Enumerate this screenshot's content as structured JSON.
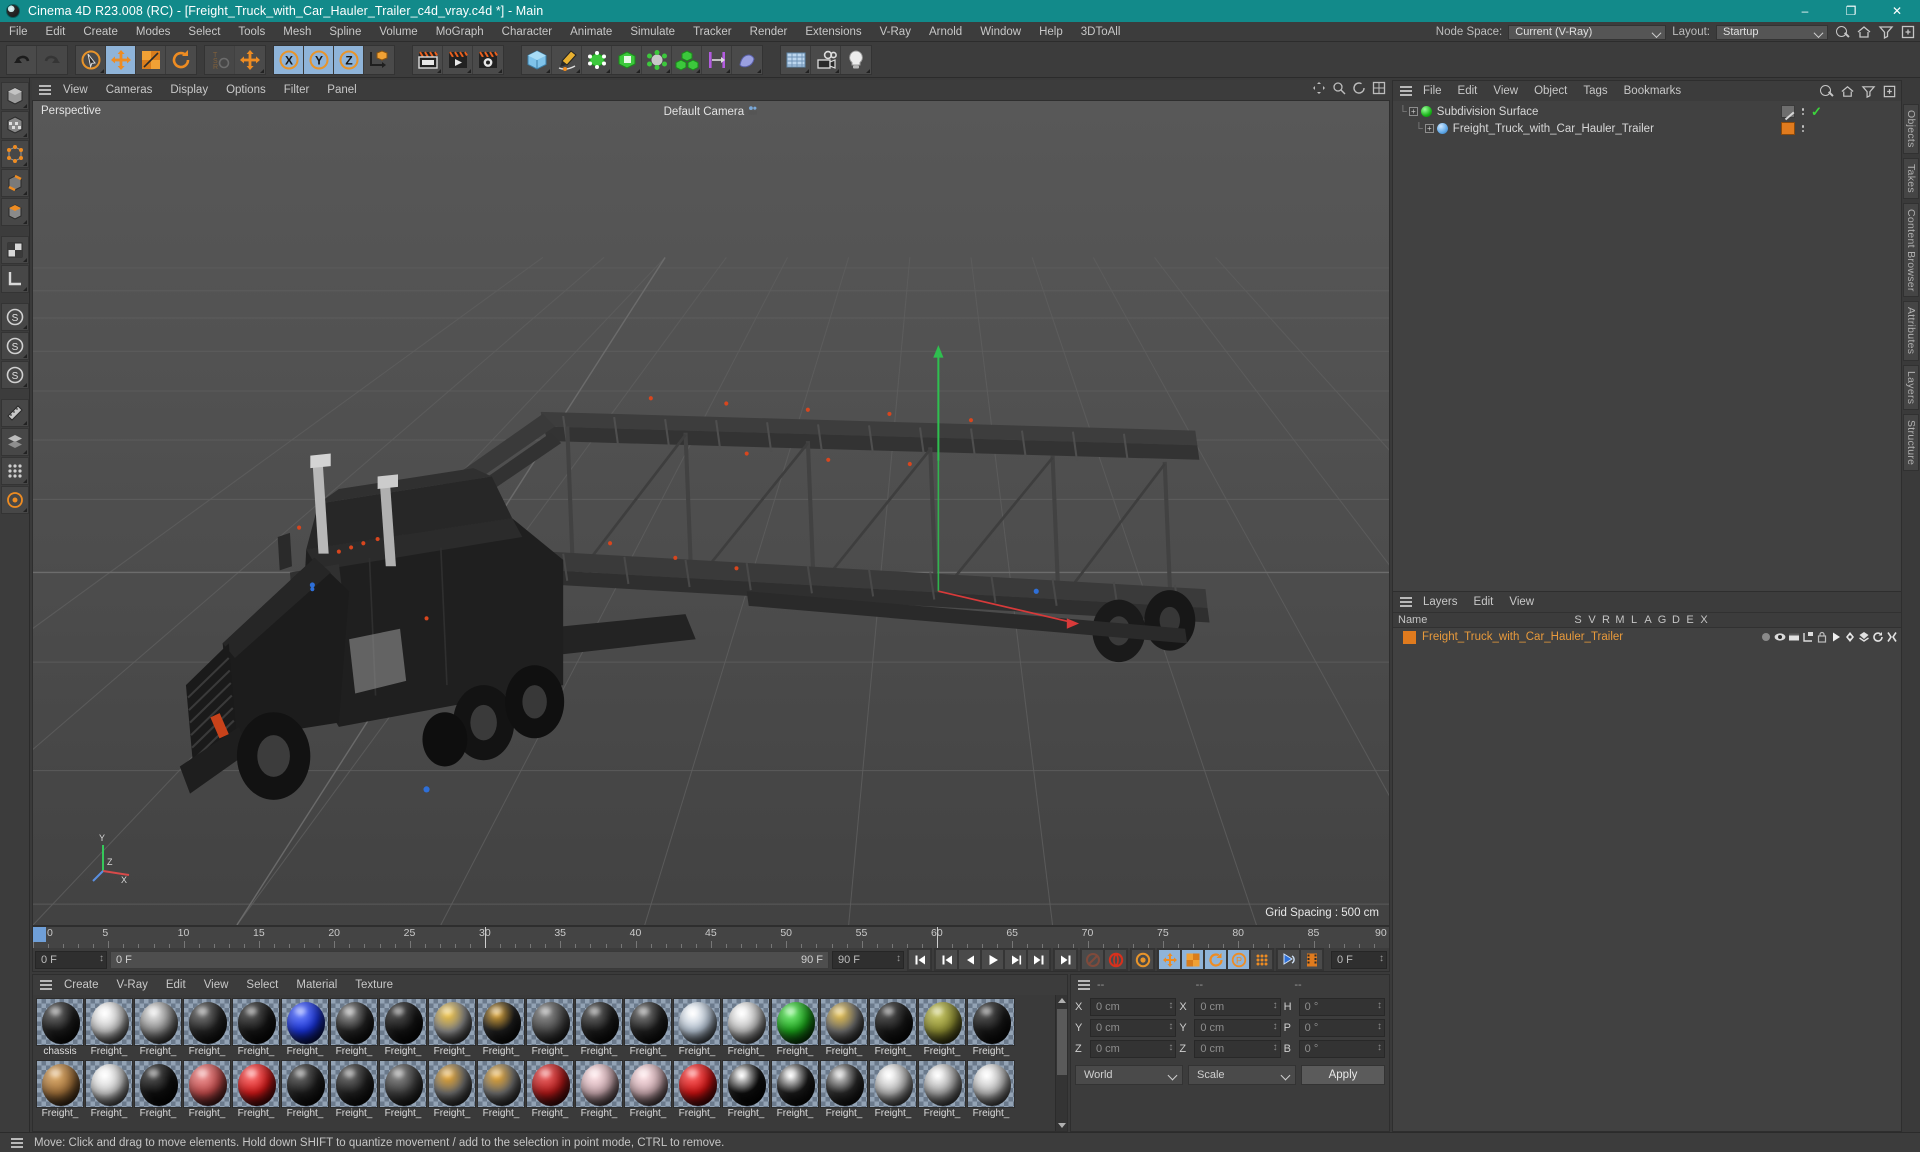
{
  "window": {
    "title": "Cinema 4D R23.008 (RC) - [Freight_Truck_with_Car_Hauler_Trailer_c4d_vray.c4d *] - Main",
    "minimize": "–",
    "maximize": "❐",
    "close": "✕",
    "accent": "#128a8a"
  },
  "menubar": {
    "items": [
      "File",
      "Edit",
      "Create",
      "Modes",
      "Select",
      "Tools",
      "Mesh",
      "Spline",
      "Volume",
      "MoGraph",
      "Character",
      "Animate",
      "Simulate",
      "Tracker",
      "Render",
      "Extensions",
      "V-Ray",
      "Arnold",
      "Window",
      "Help",
      "3DToAll"
    ],
    "node_space_label": "Node Space:",
    "node_space_value": "Current (V-Ray)",
    "layout_label": "Layout:",
    "layout_value": "Startup"
  },
  "toolbar": {
    "groups": [
      {
        "name": "history",
        "buttons": [
          {
            "name": "undo-button",
            "icon": "undo",
            "state": "normal"
          },
          {
            "name": "redo-button",
            "icon": "redo",
            "state": "dim"
          }
        ]
      },
      {
        "name": "tools",
        "buttons": [
          {
            "name": "select-tool",
            "icon": "cursor-circle",
            "state": "normal"
          },
          {
            "name": "move-tool",
            "icon": "move",
            "state": "selected"
          },
          {
            "name": "scale-tool",
            "icon": "scale",
            "state": "normal"
          },
          {
            "name": "rotate-tool",
            "icon": "rotate",
            "state": "normal"
          }
        ]
      },
      {
        "name": "tsr",
        "buttons": [
          {
            "name": "tsr-tool",
            "icon": "tsr",
            "state": "dim"
          },
          {
            "name": "move-alt-tool",
            "icon": "move",
            "state": "normal"
          }
        ]
      },
      {
        "name": "axis-locks",
        "buttons": [
          {
            "name": "lock-x-button",
            "icon": "x-axis",
            "state": "selected"
          },
          {
            "name": "lock-y-button",
            "icon": "y-axis",
            "state": "selected"
          },
          {
            "name": "lock-z-button",
            "icon": "z-axis",
            "state": "selected"
          },
          {
            "name": "world-object-coords-button",
            "icon": "world-cube",
            "state": "normal"
          }
        ]
      },
      {
        "name": "render",
        "buttons": [
          {
            "name": "render-view-button",
            "icon": "clapper-view",
            "state": "normal"
          },
          {
            "name": "render-to-picture-viewer-button",
            "icon": "clapper-play",
            "state": "normal"
          },
          {
            "name": "render-settings-button",
            "icon": "clapper-gear",
            "state": "normal"
          }
        ]
      },
      {
        "name": "primitives",
        "buttons": [
          {
            "name": "cube-primitive-button",
            "icon": "cube-blue",
            "state": "normal"
          },
          {
            "name": "pen-spline-button",
            "icon": "pen",
            "state": "normal"
          },
          {
            "name": "nurbs-generator-button",
            "icon": "subdivision",
            "state": "normal"
          },
          {
            "name": "array-generator-button",
            "icon": "green-box",
            "state": "normal"
          },
          {
            "name": "deformer-button",
            "icon": "deformer",
            "state": "normal"
          },
          {
            "name": "mograph-button",
            "icon": "cloner",
            "state": "normal"
          },
          {
            "name": "scene-helper-button",
            "icon": "magnets",
            "state": "normal"
          },
          {
            "name": "field-button",
            "icon": "field",
            "state": "normal"
          }
        ]
      },
      {
        "name": "scene",
        "buttons": [
          {
            "name": "floor-button",
            "icon": "floor-grid",
            "state": "normal"
          },
          {
            "name": "camera-button",
            "icon": "camera",
            "state": "normal"
          },
          {
            "name": "light-button",
            "icon": "light-bulb",
            "state": "normal"
          }
        ]
      }
    ]
  },
  "leftrail": {
    "items": [
      {
        "name": "model-mode-button",
        "icon": "cube"
      },
      {
        "name": "texture-mode-button",
        "icon": "checker-cube"
      },
      {
        "name": "points-mode-button",
        "icon": "points"
      },
      {
        "name": "edges-mode-button",
        "icon": "edges"
      },
      {
        "name": "polygons-mode-button",
        "icon": "polygons"
      },
      {
        "name": "viewport-solo-button",
        "icon": "solo"
      },
      {
        "name": "workplane-button",
        "icon": "workplane"
      },
      {
        "name": "enable-axis-button",
        "icon": "s-axis"
      },
      {
        "name": "snap-button",
        "icon": "s-snap"
      },
      {
        "name": "quantize-button",
        "icon": "s-quant"
      },
      {
        "name": "measure-button",
        "icon": "ruler"
      },
      {
        "name": "layer-button",
        "icon": "layers-stack"
      },
      {
        "name": "grid-button",
        "icon": "grid-dots"
      },
      {
        "name": "dynamics-button",
        "icon": "dyn"
      }
    ]
  },
  "viewport": {
    "menu": [
      "View",
      "Cameras",
      "Display",
      "Options",
      "Filter",
      "Panel"
    ],
    "label": "Perspective",
    "camera": "Default Camera",
    "grid_spacing": "Grid Spacing : 500 cm",
    "axis": {
      "x": "X",
      "y": "Y",
      "z": "Z"
    },
    "background_top": "#5a5a5a",
    "background_bottom": "#434343"
  },
  "timeline": {
    "ticks": [
      {
        "label": "0",
        "frame": 0
      },
      {
        "label": "5",
        "frame": 5
      },
      {
        "label": "10",
        "frame": 10
      },
      {
        "label": "15",
        "frame": 15
      },
      {
        "label": "20",
        "frame": 20
      },
      {
        "label": "25",
        "frame": 25
      },
      {
        "label": "30",
        "frame": 30
      },
      {
        "label": "35",
        "frame": 35
      },
      {
        "label": "40",
        "frame": 40
      },
      {
        "label": "45",
        "frame": 45
      },
      {
        "label": "50",
        "frame": 50
      },
      {
        "label": "55",
        "frame": 55
      },
      {
        "label": "60",
        "frame": 60
      },
      {
        "label": "65",
        "frame": 65
      },
      {
        "label": "70",
        "frame": 70
      },
      {
        "label": "75",
        "frame": 75
      },
      {
        "label": "80",
        "frame": 80
      },
      {
        "label": "85",
        "frame": 85
      },
      {
        "label": "90",
        "frame": 90
      }
    ],
    "current_frame_field": "0 F",
    "start_field": "0 F",
    "preview_start": "0 F",
    "preview_end": "90 F",
    "end_field": "90 F",
    "right_frame_field": "0 F",
    "min_frame": 0,
    "max_frame": 90,
    "playhead_frame": 0,
    "buttons": [
      {
        "name": "go-to-start-button",
        "icon": "skip-start"
      },
      {
        "name": "go-to-previous-keyframe-button",
        "icon": "prev-key"
      },
      {
        "name": "go-to-previous-frame-button",
        "icon": "prev-frame"
      },
      {
        "name": "play-button",
        "icon": "play"
      },
      {
        "name": "go-to-next-frame-button",
        "icon": "next-frame"
      },
      {
        "name": "go-to-next-keyframe-button",
        "icon": "next-key"
      },
      {
        "name": "go-to-end-button",
        "icon": "skip-end"
      },
      {
        "name": "record-active-objects-button",
        "icon": "record-dim"
      },
      {
        "name": "autokeying-button",
        "icon": "record"
      },
      {
        "name": "keyframe-selection-button",
        "icon": "key-gear"
      },
      {
        "name": "position-key-button",
        "icon": "pos-key",
        "state": "selected"
      },
      {
        "name": "scale-key-button",
        "icon": "scale-key",
        "state": "selected"
      },
      {
        "name": "rotation-key-button",
        "icon": "rot-key",
        "state": "selected"
      },
      {
        "name": "parameter-key-button",
        "icon": "param-key",
        "state": "selected"
      },
      {
        "name": "point-level-animation-button",
        "icon": "pla"
      },
      {
        "name": "animation-mode-button",
        "icon": "anim-mode"
      },
      {
        "name": "timeline-mode-button",
        "icon": "film"
      }
    ]
  },
  "materials": {
    "menu": [
      "Create",
      "V-Ray",
      "Edit",
      "View",
      "Select",
      "Material",
      "Texture"
    ],
    "row1": [
      {
        "name": "chassis",
        "color": "#1b1b1b",
        "highlight": "#6f6f6f"
      },
      {
        "name": "Freight_",
        "color": "#c9c9c9",
        "highlight": "#ffffff"
      },
      {
        "name": "Freight_",
        "color": "#8e8e8e",
        "highlight": "#e8e8e8"
      },
      {
        "name": "Freight_",
        "color": "#242424",
        "highlight": "#7a7a7a"
      },
      {
        "name": "Freight_",
        "color": "#151515",
        "highlight": "#5a5a5a"
      },
      {
        "name": "Freight_",
        "color": "#1832d6",
        "highlight": "#6f86ff"
      },
      {
        "name": "Freight_",
        "color": "#232323",
        "highlight": "#9a9a9a"
      },
      {
        "name": "Freight_",
        "color": "#131313",
        "highlight": "#4f4f4f"
      },
      {
        "name": "Freight_",
        "color": "#8a8a8a",
        "highlight": "#f0c03a"
      },
      {
        "name": "Freight_",
        "color": "#1d1d1d",
        "highlight": "#e0a83a"
      },
      {
        "name": "Freight_",
        "color": "#4a4a4a",
        "highlight": "#8e8e8e"
      },
      {
        "name": "Freight_",
        "color": "#1a1a1a",
        "highlight": "#6a6a6a"
      },
      {
        "name": "Freight_",
        "color": "#1f1f1f",
        "highlight": "#7e7e7e"
      },
      {
        "name": "Freight_",
        "color": "#b6c4d4",
        "highlight": "#ffffff"
      },
      {
        "name": "Freight_",
        "color": "#c2c2c2",
        "highlight": "#ffffff"
      },
      {
        "name": "Freight_",
        "color": "#1aa01a",
        "highlight": "#7df07d"
      },
      {
        "name": "Freight_",
        "color": "#6f6f6f",
        "highlight": "#e8c04a"
      },
      {
        "name": "Freight_",
        "color": "#161616",
        "highlight": "#555555"
      },
      {
        "name": "Freight_",
        "color": "#8d8d32",
        "highlight": "#c9c96a"
      },
      {
        "name": "Freight_",
        "color": "#161616",
        "highlight": "#565656"
      }
    ],
    "row2": [
      {
        "name": "Freight_",
        "color": "#a0703a",
        "highlight": "#e0b070"
      },
      {
        "name": "Freight_",
        "color": "#cfcfcf",
        "highlight": "#ffffff"
      },
      {
        "name": "Freight_",
        "color": "#0f0f0f",
        "highlight": "#565656"
      },
      {
        "name": "Freight_",
        "color": "#c04a4a",
        "highlight": "#f09a9a"
      },
      {
        "name": "Freight_",
        "color": "#d01818",
        "highlight": "#ff7a7a"
      },
      {
        "name": "Freight_",
        "color": "#1d1d1d",
        "highlight": "#6a6a6a"
      },
      {
        "name": "Freight_",
        "color": "#202020",
        "highlight": "#6f6f6f"
      },
      {
        "name": "Freight_",
        "color": "#3e3e3e",
        "highlight": "#8a8a8a"
      },
      {
        "name": "Freight_",
        "color": "#707070",
        "highlight": "#e8a42a"
      },
      {
        "name": "Freight_",
        "color": "#707070",
        "highlight": "#e8a42a"
      },
      {
        "name": "Freight_",
        "color": "#b01818",
        "highlight": "#ef6a6a"
      },
      {
        "name": "Freight_",
        "color": "#c9a8ae",
        "highlight": "#ffe4e8"
      },
      {
        "name": "Freight_",
        "color": "#c9a8ae",
        "highlight": "#ffe4e8"
      },
      {
        "name": "Freight_",
        "color": "#cc1212",
        "highlight": "#ff6a6a"
      },
      {
        "name": "Freight_",
        "color": "#0e0e0e",
        "highlight": "#ffffff"
      },
      {
        "name": "Freight_",
        "color": "#1a1a1a",
        "highlight": "#ffffff"
      },
      {
        "name": "Freight_",
        "color": "#2a2a2a",
        "highlight": "#d8d8d8"
      },
      {
        "name": "Freight_",
        "color": "#b8b8b8",
        "highlight": "#ffffff"
      },
      {
        "name": "Freight_",
        "color": "#a8a8a8",
        "highlight": "#ffffff"
      },
      {
        "name": "Freight_",
        "color": "#bdbdbd",
        "highlight": "#ffffff"
      }
    ]
  },
  "coordinates": {
    "header": [
      "--",
      "--",
      "--"
    ],
    "rows": [
      {
        "pos_tag": "X",
        "pos_value": "0 cm",
        "size_tag": "X",
        "size_value": "0 cm",
        "rot_tag": "H",
        "rot_value": "0 °"
      },
      {
        "pos_tag": "Y",
        "pos_value": "0 cm",
        "size_tag": "Y",
        "size_value": "0 cm",
        "rot_tag": "P",
        "rot_value": "0 °"
      },
      {
        "pos_tag": "Z",
        "pos_value": "0 cm",
        "size_tag": "Z",
        "size_value": "0 cm",
        "rot_tag": "B",
        "rot_value": "0 °"
      }
    ],
    "world_select": "World",
    "scale_select": "Scale",
    "apply_button": "Apply"
  },
  "objects": {
    "menu": [
      "File",
      "Edit",
      "View",
      "Object",
      "Tags",
      "Bookmarks"
    ],
    "rows": [
      {
        "name": "Subdivision Surface",
        "depth": 0,
        "icon": "subdivision-surface-icon",
        "tag": "grey",
        "check": true,
        "selected": false
      },
      {
        "name": "Freight_Truck_with_Car_Hauler_Trailer",
        "depth": 1,
        "icon": "null-object-icon",
        "tag": "orange",
        "check": false,
        "selected": false
      }
    ]
  },
  "layers": {
    "menu": [
      "Layers",
      "Edit",
      "View"
    ],
    "columns": [
      "Name",
      "S",
      "V",
      "R",
      "M",
      "L",
      "A",
      "G",
      "D",
      "E",
      "X"
    ],
    "rows": [
      {
        "name": "Freight_Truck_with_Car_Hauler_Trailer",
        "color": "#e07b1e"
      }
    ]
  },
  "right_tabs": [
    "Objects",
    "Takes",
    "Content Browser",
    "Attributes",
    "Layers",
    "Structure"
  ],
  "status": {
    "message": "Move: Click and drag to move elements. Hold down SHIFT to quantize movement / add to the selection in point mode, CTRL to remove."
  }
}
